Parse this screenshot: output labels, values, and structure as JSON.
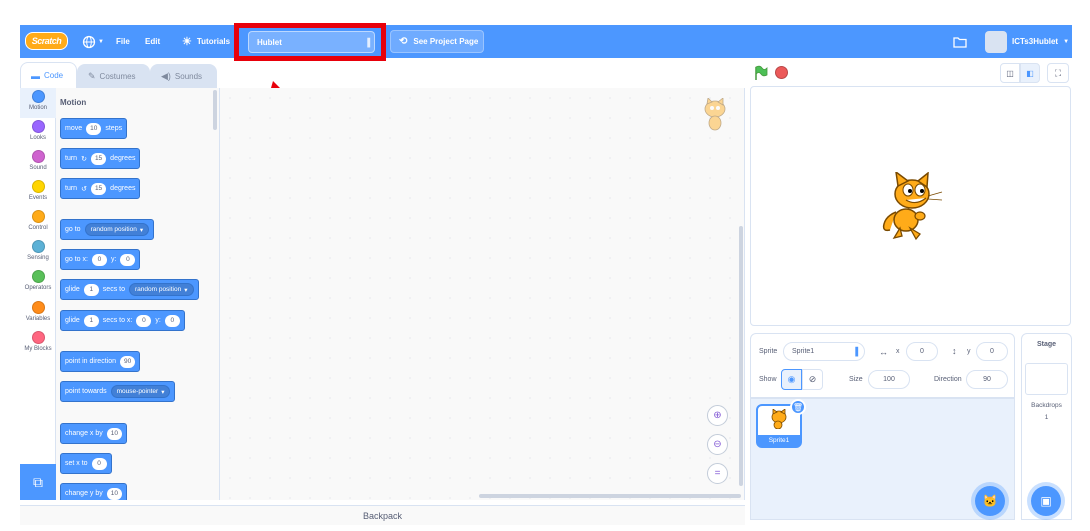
{
  "menu": {
    "logo": "Scratch",
    "file": "File",
    "edit": "Edit",
    "tutorials": "Tutorials",
    "project_title": "Hublet",
    "see_project": "See Project Page",
    "username": "ICTs3Hublet"
  },
  "tabs": {
    "code": "Code",
    "costumes": "Costumes",
    "sounds": "Sounds"
  },
  "categories": [
    {
      "label": "Motion",
      "color": "#4c97ff"
    },
    {
      "label": "Looks",
      "color": "#9966ff"
    },
    {
      "label": "Sound",
      "color": "#cf63cf"
    },
    {
      "label": "Events",
      "color": "#ffd500"
    },
    {
      "label": "Control",
      "color": "#ffab19"
    },
    {
      "label": "Sensing",
      "color": "#5cb1d6"
    },
    {
      "label": "Operators",
      "color": "#59c059"
    },
    {
      "label": "Variables",
      "color": "#ff8c1a"
    },
    {
      "label": "My Blocks",
      "color": "#ff6680"
    }
  ],
  "palette": {
    "heading": "Motion",
    "move": {
      "a": "move",
      "n": "10",
      "b": "steps"
    },
    "turn_right": {
      "a": "turn",
      "n": "15",
      "b": "degrees"
    },
    "turn_left": {
      "a": "turn",
      "n": "15",
      "b": "degrees"
    },
    "goto": {
      "a": "go to",
      "d": "random position"
    },
    "goto_xy": {
      "a": "go to x:",
      "x": "0",
      "b": "y:",
      "y": "0"
    },
    "glide_to": {
      "a": "glide",
      "n": "1",
      "b": "secs to",
      "d": "random position"
    },
    "glide_xy": {
      "a": "glide",
      "n": "1",
      "b": "secs to x:",
      "x": "0",
      "c": "y:",
      "y": "0"
    },
    "point_dir": {
      "a": "point in direction",
      "n": "90"
    },
    "point_towards": {
      "a": "point towards",
      "d": "mouse-pointer"
    },
    "change_x": {
      "a": "change x by",
      "n": "10"
    },
    "set_x": {
      "a": "set x to",
      "n": "0"
    },
    "change_y": {
      "a": "change y by",
      "n": "10"
    }
  },
  "backpack": "Backpack",
  "sprite_info": {
    "sprite_label": "Sprite",
    "sprite_name": "Sprite1",
    "x_label": "x",
    "x_value": "0",
    "y_label": "y",
    "y_value": "0",
    "show_label": "Show",
    "size_label": "Size",
    "size_value": "100",
    "direction_label": "Direction",
    "direction_value": "90"
  },
  "sprite_tile": "Sprite1",
  "stage_pane": {
    "title": "Stage",
    "backdrops_label": "Backdrops",
    "backdrops_count": "1"
  }
}
